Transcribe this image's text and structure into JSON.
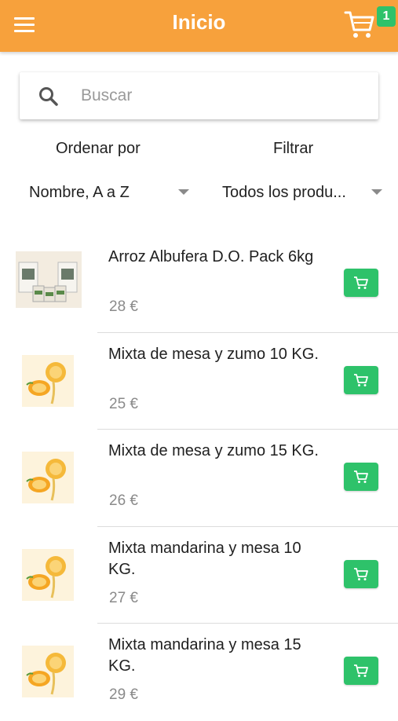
{
  "header": {
    "title": "Inicio",
    "menu_icon": "hamburger-menu-icon",
    "cart_icon": "shopping-cart-icon",
    "cart_count": "1"
  },
  "search": {
    "placeholder": "Buscar",
    "value": ""
  },
  "controls": {
    "sort_label": "Ordenar por",
    "sort_value": "Nombre, A a Z",
    "filter_label": "Filtrar",
    "filter_value": "Todos los produ..."
  },
  "products": [
    {
      "name": "Arroz Albufera D.O. Pack 6kg",
      "price": "28 €",
      "image": "rice-pack"
    },
    {
      "name": "Mixta de mesa y zumo 10 KG.",
      "price": "25 €",
      "image": "orange-logo"
    },
    {
      "name": "Mixta de mesa y zumo 15 KG.",
      "price": "26 €",
      "image": "orange-logo"
    },
    {
      "name": "Mixta mandarina y mesa 10 KG.",
      "price": "27 €",
      "image": "orange-logo"
    },
    {
      "name": "Mixta mandarina y mesa 15 KG.",
      "price": "29 €",
      "image": "orange-logo"
    }
  ],
  "colors": {
    "appbar": "#f7a13c",
    "accent_green": "#2ec26a",
    "price_gray": "#8a8a8a"
  }
}
